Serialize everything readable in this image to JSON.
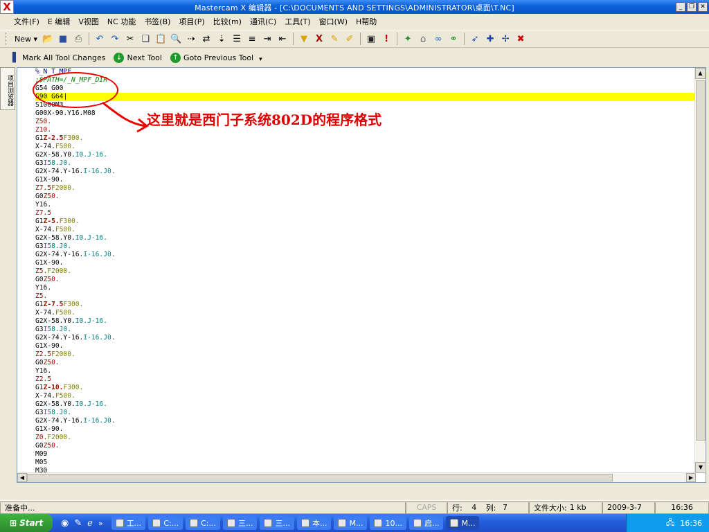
{
  "window": {
    "title": "Mastercam X 编辑器 - [C:\\DOCUMENTS AND SETTINGS\\ADMINISTRATOR\\桌面\\T.NC]",
    "logo": "X"
  },
  "menu": [
    "文件(F)",
    "E 编辑",
    "V视图",
    "NC 功能",
    "书签(B)",
    "项目(P)",
    "比较(m)",
    "通讯(C)",
    "工具(T)",
    "窗口(W)",
    "H帮助"
  ],
  "toolbar1": {
    "new_label": "New"
  },
  "toolbar2": {
    "mark_all": "Mark All Tool Changes",
    "next_tool": "Next Tool",
    "goto_prev": "Goto Previous Tool"
  },
  "side_tab": "项目浏览器",
  "annotation": {
    "text": "这里就是西门子系统802D的程序格式"
  },
  "code_lines": [
    [
      {
        "t": "%_N_T_MPF",
        "c": "#000080"
      }
    ],
    [
      {
        "t": ";$PATH=/_N_MPF_DIR",
        "c": "#008000",
        "i": true
      }
    ],
    [
      {
        "t": "G54 G00",
        "c": "#000"
      }
    ],
    [
      {
        "t": "G90 G64",
        "c": "#000"
      }
    ],
    [
      {
        "t": "S1000M3",
        "c": "#000"
      }
    ],
    [
      {
        "t": "G00X-90.Y16.M08",
        "c": "#000"
      }
    ],
    [
      {
        "t": "Z50.",
        "c": "#b00000"
      }
    ],
    [
      {
        "t": "Z10.",
        "c": "#b00000"
      }
    ],
    [
      {
        "t": "G1",
        "c": "#000"
      },
      {
        "t": "Z-2.5",
        "c": "#b00000",
        "b": true
      },
      {
        "t": "F300.",
        "c": "#808000"
      }
    ],
    [
      {
        "t": "X-74.",
        "c": "#000"
      },
      {
        "t": "F500.",
        "c": "#808000"
      }
    ],
    [
      {
        "t": "G2X-58.Y0.",
        "c": "#000"
      },
      {
        "t": "I0.J-16.",
        "c": "#008080"
      }
    ],
    [
      {
        "t": "G3",
        "c": "#000"
      },
      {
        "t": "I58.J0.",
        "c": "#008080"
      }
    ],
    [
      {
        "t": "G2X-74.Y-16.",
        "c": "#000"
      },
      {
        "t": "I-16.J0.",
        "c": "#008080"
      }
    ],
    [
      {
        "t": "G1X-90.",
        "c": "#000"
      }
    ],
    [
      {
        "t": "Z7.5",
        "c": "#b00000"
      },
      {
        "t": "F2000.",
        "c": "#808000"
      }
    ],
    [
      {
        "t": "G0",
        "c": "#000"
      },
      {
        "t": "Z50.",
        "c": "#b00000"
      }
    ],
    [
      {
        "t": "Y16.",
        "c": "#000"
      }
    ],
    [
      {
        "t": "Z7.5",
        "c": "#b00000"
      }
    ],
    [
      {
        "t": "G1",
        "c": "#000"
      },
      {
        "t": "Z-5.",
        "c": "#b00000",
        "b": true
      },
      {
        "t": "F300.",
        "c": "#808000"
      }
    ],
    [
      {
        "t": "X-74.",
        "c": "#000"
      },
      {
        "t": "F500.",
        "c": "#808000"
      }
    ],
    [
      {
        "t": "G2X-58.Y0.",
        "c": "#000"
      },
      {
        "t": "I0.J-16.",
        "c": "#008080"
      }
    ],
    [
      {
        "t": "G3",
        "c": "#000"
      },
      {
        "t": "I58.J0.",
        "c": "#008080"
      }
    ],
    [
      {
        "t": "G2X-74.Y-16.",
        "c": "#000"
      },
      {
        "t": "I-16.J0.",
        "c": "#008080"
      }
    ],
    [
      {
        "t": "G1X-90.",
        "c": "#000"
      }
    ],
    [
      {
        "t": "Z5.",
        "c": "#b00000"
      },
      {
        "t": "F2000.",
        "c": "#808000"
      }
    ],
    [
      {
        "t": "G0",
        "c": "#000"
      },
      {
        "t": "Z50.",
        "c": "#b00000"
      }
    ],
    [
      {
        "t": "Y16.",
        "c": "#000"
      }
    ],
    [
      {
        "t": "Z5.",
        "c": "#b00000"
      }
    ],
    [
      {
        "t": "G1",
        "c": "#000"
      },
      {
        "t": "Z-7.5",
        "c": "#b00000",
        "b": true
      },
      {
        "t": "F300.",
        "c": "#808000"
      }
    ],
    [
      {
        "t": "X-74.",
        "c": "#000"
      },
      {
        "t": "F500.",
        "c": "#808000"
      }
    ],
    [
      {
        "t": "G2X-58.Y0.",
        "c": "#000"
      },
      {
        "t": "I0.J-16.",
        "c": "#008080"
      }
    ],
    [
      {
        "t": "G3",
        "c": "#000"
      },
      {
        "t": "I58.J0.",
        "c": "#008080"
      }
    ],
    [
      {
        "t": "G2X-74.Y-16.",
        "c": "#000"
      },
      {
        "t": "I-16.J0.",
        "c": "#008080"
      }
    ],
    [
      {
        "t": "G1X-90.",
        "c": "#000"
      }
    ],
    [
      {
        "t": "Z2.5",
        "c": "#b00000"
      },
      {
        "t": "F2000.",
        "c": "#808000"
      }
    ],
    [
      {
        "t": "G0",
        "c": "#000"
      },
      {
        "t": "Z50.",
        "c": "#b00000"
      }
    ],
    [
      {
        "t": "Y16.",
        "c": "#000"
      }
    ],
    [
      {
        "t": "Z2.5",
        "c": "#b00000"
      }
    ],
    [
      {
        "t": "G1",
        "c": "#000"
      },
      {
        "t": "Z-10.",
        "c": "#b00000",
        "b": true
      },
      {
        "t": "F300.",
        "c": "#808000"
      }
    ],
    [
      {
        "t": "X-74.",
        "c": "#000"
      },
      {
        "t": "F500.",
        "c": "#808000"
      }
    ],
    [
      {
        "t": "G2X-58.Y0.",
        "c": "#000"
      },
      {
        "t": "I0.J-16.",
        "c": "#008080"
      }
    ],
    [
      {
        "t": "G3",
        "c": "#000"
      },
      {
        "t": "I58.J0.",
        "c": "#008080"
      }
    ],
    [
      {
        "t": "G2X-74.Y-16.",
        "c": "#000"
      },
      {
        "t": "I-16.J0.",
        "c": "#008080"
      }
    ],
    [
      {
        "t": "G1X-90.",
        "c": "#000"
      }
    ],
    [
      {
        "t": "Z0.",
        "c": "#b00000"
      },
      {
        "t": "F2000.",
        "c": "#808000"
      }
    ],
    [
      {
        "t": "G0",
        "c": "#000"
      },
      {
        "t": "Z50.",
        "c": "#b00000"
      }
    ],
    [
      {
        "t": "M09",
        "c": "#000"
      }
    ],
    [
      {
        "t": "M05",
        "c": "#000"
      }
    ],
    [
      {
        "t": "M30",
        "c": "#000"
      }
    ]
  ],
  "highlight_line": 3,
  "status": {
    "ready": "准备中...",
    "caps": "CAPS",
    "row_label": "行:",
    "row": "4",
    "col_label": "列:",
    "col": "7",
    "size_label": "文件大小:",
    "size": "1 kb",
    "date": "2009-3-7",
    "time": "16:36"
  },
  "taskbar": {
    "start": "Start",
    "items": [
      {
        "label": "工...",
        "active": false
      },
      {
        "label": "C:...",
        "active": false
      },
      {
        "label": "C:...",
        "active": false
      },
      {
        "label": "三...",
        "active": false
      },
      {
        "label": "三...",
        "active": false
      },
      {
        "label": "本...",
        "active": false
      },
      {
        "label": "M...",
        "active": false
      },
      {
        "label": "10...",
        "active": false
      },
      {
        "label": "启...",
        "active": false
      },
      {
        "label": "M...",
        "active": true
      }
    ],
    "clock": "16:36"
  },
  "colors": {
    "titlebar": "#0a5fd8",
    "highlight": "#ffff00",
    "annotation": "#e00000"
  }
}
